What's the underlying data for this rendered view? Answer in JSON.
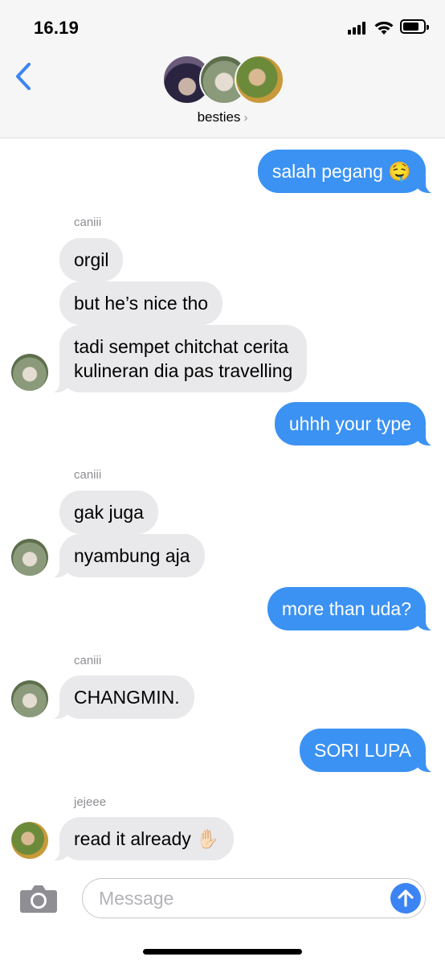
{
  "status_bar": {
    "time": "16.19"
  },
  "header": {
    "group_name": "besties",
    "chevron": "›"
  },
  "messages": [
    {
      "side": "out",
      "text": "salah pegang 🤤"
    },
    {
      "side": "in",
      "sender": "caniii",
      "text": "orgil"
    },
    {
      "side": "in",
      "text": "but he’s nice tho"
    },
    {
      "side": "in",
      "text_line1": "tadi sempet chitchat cerita",
      "text_line2": "kulineran dia pas travelling"
    },
    {
      "side": "out",
      "text": "uhhh your type"
    },
    {
      "side": "in",
      "sender": "caniii",
      "text": "gak juga"
    },
    {
      "side": "in",
      "text": "nyambung aja"
    },
    {
      "side": "out",
      "text": "more than uda?"
    },
    {
      "side": "in",
      "sender": "caniii",
      "text": "CHANGMIN."
    },
    {
      "side": "out",
      "text": "SORI LUPA"
    },
    {
      "side": "in",
      "sender": "jejeee",
      "text": "read it already ✋🏻"
    }
  ],
  "composer": {
    "placeholder": "Message"
  },
  "icons": {
    "back": "chevron-left-icon",
    "camera": "camera-icon",
    "send": "arrow-up-icon",
    "signal": "signal-icon",
    "wifi": "wifi-icon",
    "battery": "battery-icon"
  },
  "colors": {
    "outgoing_bubble": "#3b92f3",
    "incoming_bubble": "#e9e9eb",
    "accent": "#3b84f3",
    "sender_label": "#8e8e93"
  }
}
